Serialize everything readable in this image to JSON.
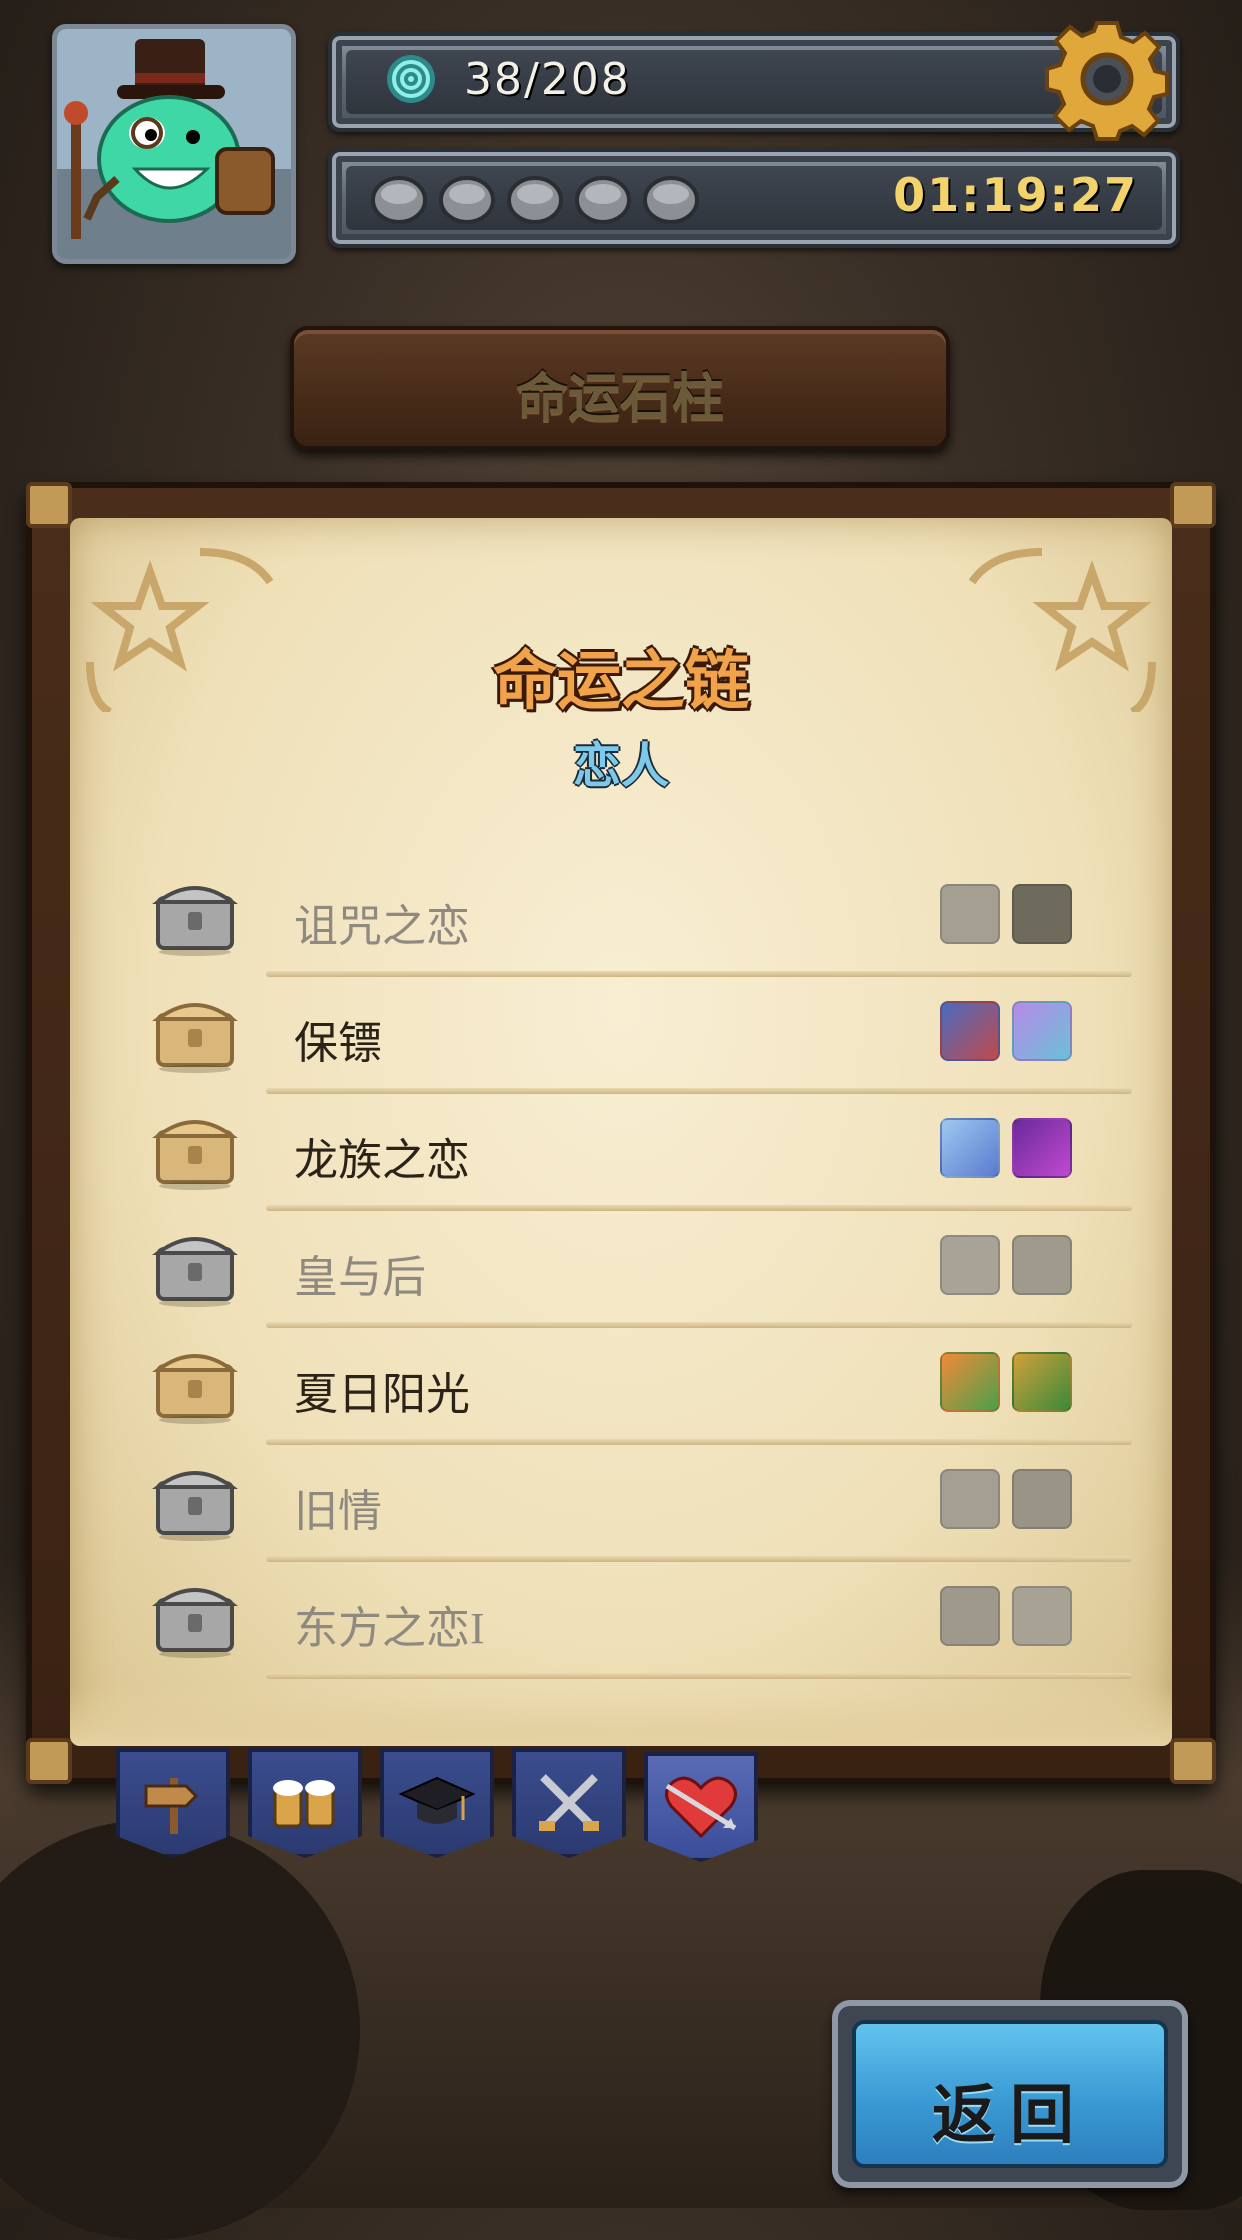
{
  "hud": {
    "energy": "38/208",
    "timer": "01:19:27",
    "stones_count": 5
  },
  "header": {
    "title": "命运石柱"
  },
  "panel": {
    "title": "命运之链",
    "subtitle": "恋人",
    "rows": [
      {
        "label": "诅咒之恋",
        "unlocked": false
      },
      {
        "label": "保镖",
        "unlocked": true
      },
      {
        "label": "龙族之恋",
        "unlocked": true
      },
      {
        "label": "皇与后",
        "unlocked": false
      },
      {
        "label": "夏日阳光",
        "unlocked": true
      },
      {
        "label": "旧情",
        "unlocked": false
      },
      {
        "label": "东方之恋I",
        "unlocked": false
      }
    ]
  },
  "tabs": [
    {
      "icon": "signpost-icon",
      "active": false
    },
    {
      "icon": "beer-mugs-icon",
      "active": false
    },
    {
      "icon": "graduation-cap-icon",
      "active": false
    },
    {
      "icon": "crossed-swords-icon",
      "active": false
    },
    {
      "icon": "heart-arrow-icon",
      "active": true
    }
  ],
  "footer": {
    "return_label": "返回"
  },
  "colors": {
    "title_orange": "#f0a34a",
    "subtitle_blue": "#7ec8e8",
    "timer_gold": "#f3d36b",
    "return_blue": "#3a9ad4"
  }
}
